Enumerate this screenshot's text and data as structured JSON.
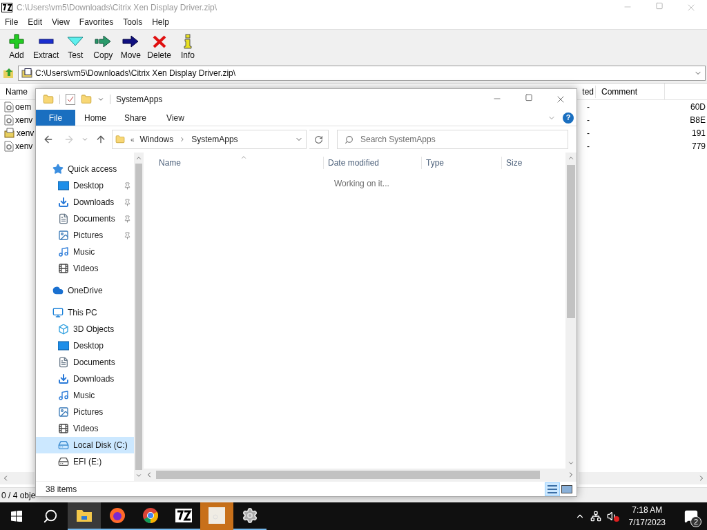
{
  "archive_window": {
    "title": "C:\\Users\\vm5\\Downloads\\Citrix Xen Display Driver.zip\\",
    "menu": [
      "File",
      "Edit",
      "View",
      "Favorites",
      "Tools",
      "Help"
    ],
    "toolbar": [
      {
        "label": "Add",
        "kind": "add"
      },
      {
        "label": "Extract",
        "kind": "extract"
      },
      {
        "label": "Test",
        "kind": "test"
      },
      {
        "label": "Copy",
        "kind": "copy"
      },
      {
        "label": "Move",
        "kind": "move"
      },
      {
        "label": "Delete",
        "kind": "delete"
      },
      {
        "label": "Info",
        "kind": "info"
      }
    ],
    "address": "C:\\Users\\vm5\\Downloads\\Citrix Xen Display Driver.zip\\",
    "columns": [
      "Name",
      "ted",
      "Comment"
    ],
    "rows": [
      {
        "name": "oem",
        "kind": "settings-file",
        "column_2": "-",
        "column_4": "60D"
      },
      {
        "name": "xenv",
        "kind": "settings-file",
        "column_2": "-",
        "column_4": "B8E"
      },
      {
        "name": "xenv",
        "kind": "installer",
        "column_2": "-",
        "column_4": "191"
      },
      {
        "name": "xenv",
        "kind": "settings-file",
        "column_2": "-",
        "column_4": "779"
      }
    ],
    "status": "0 / 4 obje"
  },
  "explorer": {
    "title": "SystemApps",
    "ribbon_tabs": [
      {
        "label": "File",
        "selected": true
      },
      {
        "label": "Home",
        "selected": false
      },
      {
        "label": "Share",
        "selected": false
      },
      {
        "label": "View",
        "selected": false
      }
    ],
    "help": "?",
    "breadcrumb_overflow": "«",
    "breadcrumb": [
      "Windows",
      "SystemApps"
    ],
    "search": {
      "placeholder": "Search SystemApps"
    },
    "nav": [
      {
        "label": "Quick access",
        "kind": "star",
        "selected": false,
        "children": [
          {
            "label": "Desktop",
            "kind": "desktop",
            "pinned": true,
            "selected": false
          },
          {
            "label": "Downloads",
            "kind": "downloads",
            "pinned": true,
            "selected": false
          },
          {
            "label": "Documents",
            "kind": "documents",
            "pinned": true,
            "selected": false
          },
          {
            "label": "Pictures",
            "kind": "pictures",
            "pinned": true,
            "selected": false
          },
          {
            "label": "Music",
            "kind": "music",
            "pinned": false,
            "selected": false
          },
          {
            "label": "Videos",
            "kind": "videos",
            "pinned": false,
            "selected": false
          }
        ]
      },
      {
        "label": "OneDrive",
        "kind": "cloud",
        "selected": false
      },
      {
        "label": "This PC",
        "kind": "pc",
        "selected": false,
        "children": [
          {
            "label": "3D Objects",
            "kind": "objects",
            "pinned": false,
            "selected": false
          },
          {
            "label": "Desktop",
            "kind": "desktop",
            "pinned": false,
            "selected": false
          },
          {
            "label": "Documents",
            "kind": "documents",
            "pinned": false,
            "selected": false
          },
          {
            "label": "Downloads",
            "kind": "downloads",
            "pinned": false,
            "selected": false
          },
          {
            "label": "Music",
            "kind": "music",
            "pinned": false,
            "selected": false
          },
          {
            "label": "Pictures",
            "kind": "pictures",
            "pinned": false,
            "selected": false
          },
          {
            "label": "Videos",
            "kind": "videos",
            "pinned": false,
            "selected": false
          },
          {
            "label": "Local Disk (C:)",
            "kind": "disk",
            "pinned": false,
            "selected": true
          },
          {
            "label": "EFI (E:)",
            "kind": "drive",
            "pinned": false,
            "selected": false
          }
        ]
      }
    ],
    "columns": [
      "Name",
      "Date modified",
      "Type",
      "Size"
    ],
    "message": "Working on it...",
    "status": "38 items"
  },
  "taskbar": {
    "apps": [
      {
        "kind": "folder",
        "selected": true,
        "flashing": false
      },
      {
        "kind": "firefox",
        "selected": false,
        "flashing": false
      },
      {
        "kind": "chrome",
        "selected": false,
        "flashing": false
      },
      {
        "kind": "sevenzip",
        "selected": false,
        "flashing": false
      },
      {
        "kind": "blank",
        "selected": false,
        "flashing": true
      },
      {
        "kind": "gears",
        "selected": false,
        "flashing": false
      }
    ],
    "time": "7:18 AM",
    "date": "7/17/2023",
    "notifications": "2"
  }
}
